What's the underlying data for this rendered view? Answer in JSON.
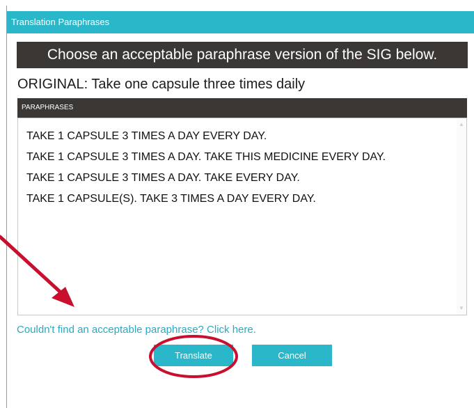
{
  "window": {
    "title": "Translation Paraphrases"
  },
  "header": {
    "text": "Choose an acceptable paraphrase version of the SIG below."
  },
  "original": {
    "text": "ORIGINAL: Take one capsule three times daily"
  },
  "paraphrases": {
    "header": "PARAPHRASES",
    "items": [
      "TAKE 1 CAPSULE 3 TIMES A DAY EVERY DAY.",
      "TAKE 1 CAPSULE 3 TIMES A DAY. TAKE THIS MEDICINE EVERY DAY.",
      "TAKE 1 CAPSULE 3 TIMES A DAY. TAKE EVERY DAY.",
      "TAKE 1 CAPSULE(S). TAKE 3 TIMES A DAY EVERY DAY."
    ]
  },
  "link": {
    "text": "Couldn't find an acceptable paraphrase? Click here."
  },
  "buttons": {
    "translate": "Translate",
    "cancel": "Cancel"
  },
  "colors": {
    "accent": "#29b7c9",
    "header_bg": "#3b3735",
    "annotation": "#c8102e"
  }
}
